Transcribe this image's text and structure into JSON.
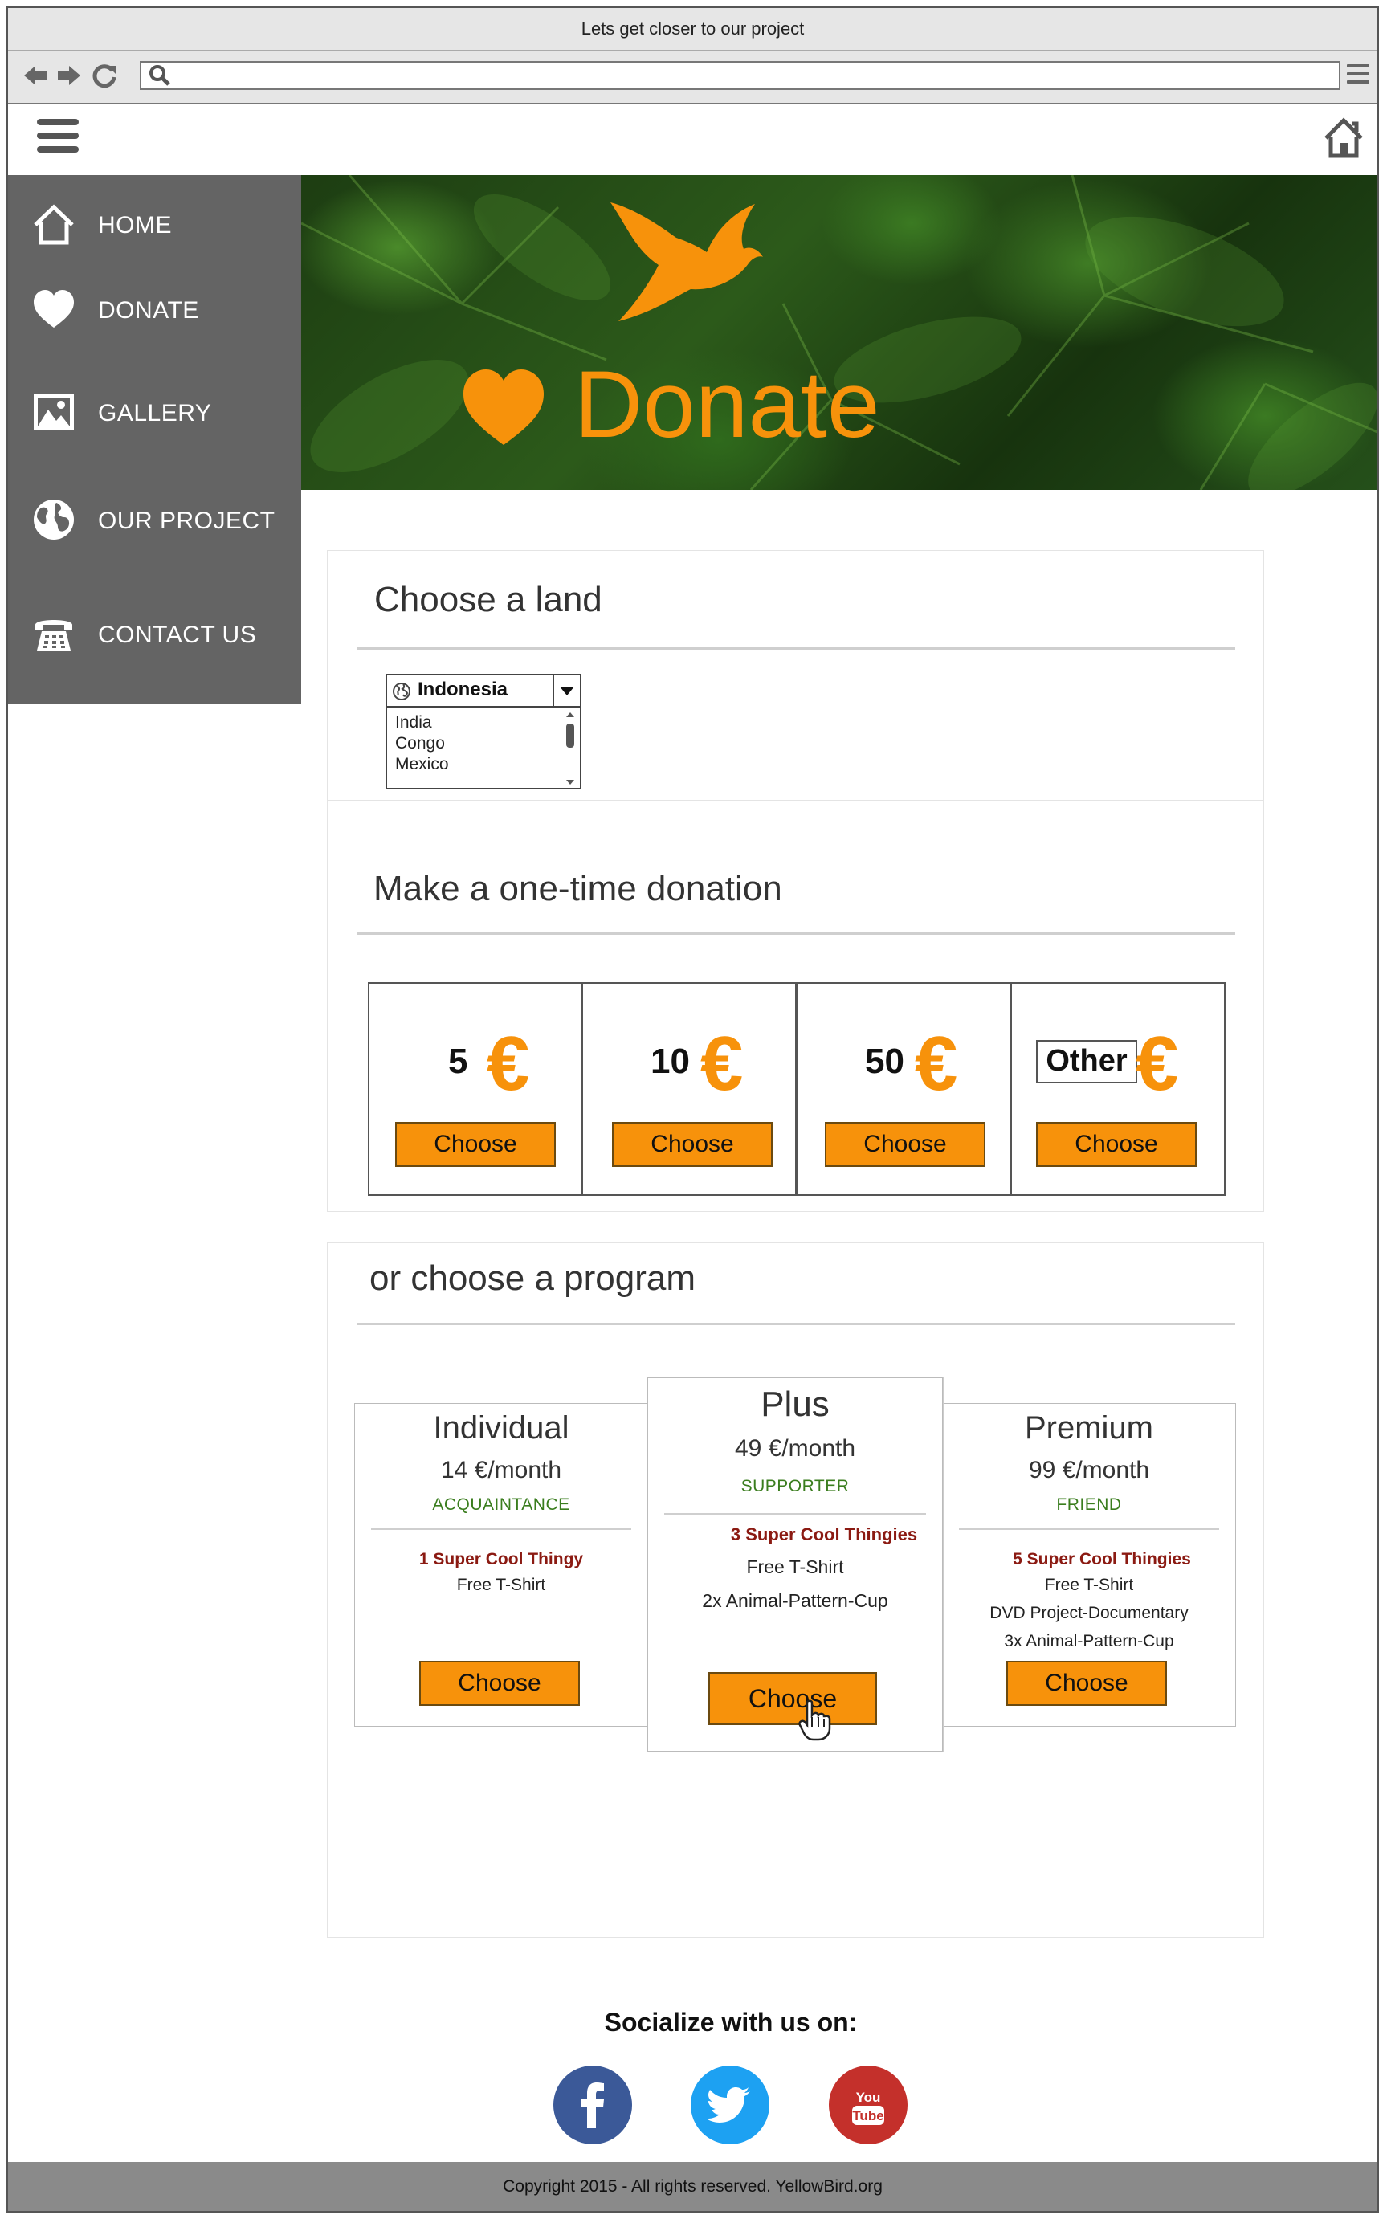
{
  "browser": {
    "window_title": "Lets get closer to our project"
  },
  "sidebar": {
    "items": [
      {
        "label": "HOME",
        "icon": "home-icon"
      },
      {
        "label": "DONATE",
        "icon": "heart-icon"
      },
      {
        "label": "GALLERY",
        "icon": "image-icon"
      },
      {
        "label": "OUR PROJECT",
        "icon": "globe-icon"
      },
      {
        "label": "CONTACT US",
        "icon": "phone-icon"
      }
    ]
  },
  "hero": {
    "title": "Donate",
    "accent_color": "#f7920b"
  },
  "land": {
    "heading": "Choose a land",
    "selected": "Indonesia",
    "options": [
      "India",
      "Congo",
      "Mexico"
    ]
  },
  "one_time": {
    "heading": "Make a one-time donation",
    "currency": "€",
    "amounts": [
      {
        "value": "5",
        "button": "Choose"
      },
      {
        "value": "10",
        "button": "Choose"
      },
      {
        "value": "50",
        "button": "Choose"
      },
      {
        "value": "Other",
        "button": "Choose"
      }
    ]
  },
  "programs": {
    "heading": "or choose a program",
    "plans": [
      {
        "name": "Individual",
        "price": "14 €/month",
        "tier": "ACQUAINTANCE",
        "main_perk": "1 Super Cool Thingy",
        "perks": [
          "Free T-Shirt"
        ],
        "button": "Choose"
      },
      {
        "name": "Plus",
        "price": "49 €/month",
        "tier": "SUPPORTER",
        "main_perk": "3 Super Cool Thingies",
        "perks": [
          "Free T-Shirt",
          "2x Animal-Pattern-Cup"
        ],
        "button": "Choose"
      },
      {
        "name": "Premium",
        "price": "99 €/month",
        "tier": "FRIEND",
        "main_perk": "5 Super Cool Thingies",
        "perks": [
          "Free T-Shirt",
          "DVD Project-Documentary",
          "3x Animal-Pattern-Cup"
        ],
        "button": "Choose"
      }
    ]
  },
  "social": {
    "heading": "Socialize with us on:",
    "networks": [
      {
        "name": "facebook",
        "glyph": "f",
        "color": "#3b5998"
      },
      {
        "name": "twitter",
        "glyph": "twitter-bird",
        "color": "#1da1f2"
      },
      {
        "name": "youtube",
        "glyph": "You Tube",
        "color": "#c4302b"
      }
    ]
  },
  "footer": {
    "text": "Copyright 2015  - All rights reserved. YellowBird.org"
  }
}
